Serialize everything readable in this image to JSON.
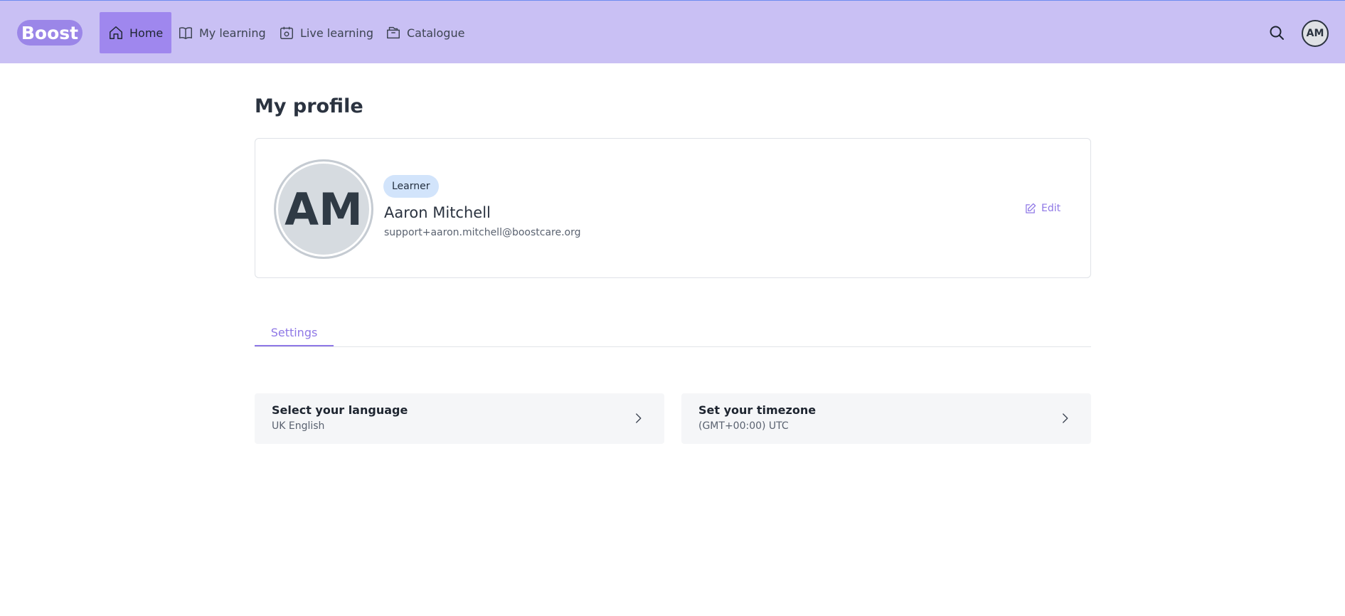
{
  "app": {
    "brand": "Boost"
  },
  "nav": {
    "items": [
      {
        "label": "Home",
        "icon": "home-icon",
        "active": true
      },
      {
        "label": "My learning",
        "icon": "book-icon",
        "active": false
      },
      {
        "label": "Live learning",
        "icon": "calendar-icon",
        "active": false
      },
      {
        "label": "Catalogue",
        "icon": "folder-icon",
        "active": false
      }
    ],
    "user_initials": "AM"
  },
  "page": {
    "title": "My profile"
  },
  "profile": {
    "initials": "AM",
    "role": "Learner",
    "name": "Aaron Mitchell",
    "email": "support+aaron.mitchell@boostcare.org",
    "edit_label": "Edit"
  },
  "tabs": [
    {
      "label": "Settings",
      "active": true
    }
  ],
  "settings": [
    {
      "title": "Select your language",
      "value": "UK English"
    },
    {
      "title": "Set your timezone",
      "value": "(GMT+00:00) UTC"
    }
  ],
  "colors": {
    "topbar": "#c9c0f4",
    "accent": "#8f78e6",
    "nav_active": "#9f87ee",
    "badge": "#d2e4fb"
  }
}
